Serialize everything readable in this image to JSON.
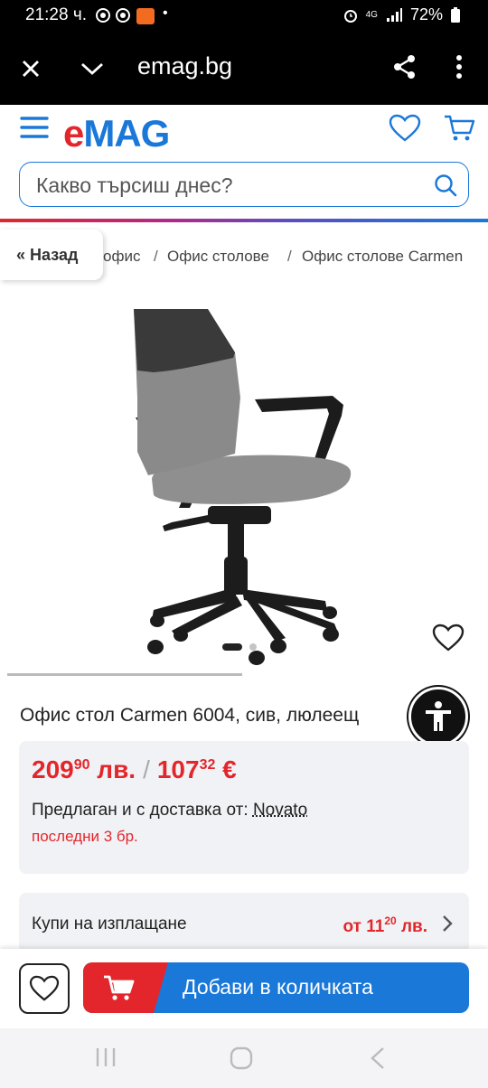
{
  "status_bar": {
    "time": "21:28 ч.",
    "network": "4G",
    "battery": "72%"
  },
  "browser": {
    "url": "emag.bg",
    "close_icon": "close-icon",
    "collapse_icon": "chevron-down-icon",
    "share_icon": "share-icon",
    "menu_icon": "more-vert-icon"
  },
  "header": {
    "logo_e": "e",
    "logo_mag": "MAG",
    "search_placeholder": "Какво търсиш днес?",
    "colors": {
      "red": "#e3262b",
      "blue": "#1a78d8"
    }
  },
  "breadcrumb": {
    "back_label": "« Назад",
    "items": [
      "офис",
      "Офис столове",
      "Офис столове Carmen"
    ],
    "separator": "/"
  },
  "product": {
    "title": "Офис стол Carmen 6004, сив, люлеещ",
    "price_bgn_int": "209",
    "price_bgn_dec": "90",
    "price_bgn_cur": "лв.",
    "price_sep": "/",
    "price_eur_int": "107",
    "price_eur_dec": "32",
    "price_eur_cur": "€",
    "seller_prefix": "Предлаган и с доставка от:",
    "seller_name": "Novato",
    "stock": "последни 3 бр.",
    "install_label": "Купи на изплащане",
    "install_prefix": "от 11",
    "install_dec": "20",
    "install_cur": "лв.",
    "gallery_index": 1,
    "gallery_total": 2
  },
  "actions": {
    "add_to_cart": "Добави в количката"
  }
}
